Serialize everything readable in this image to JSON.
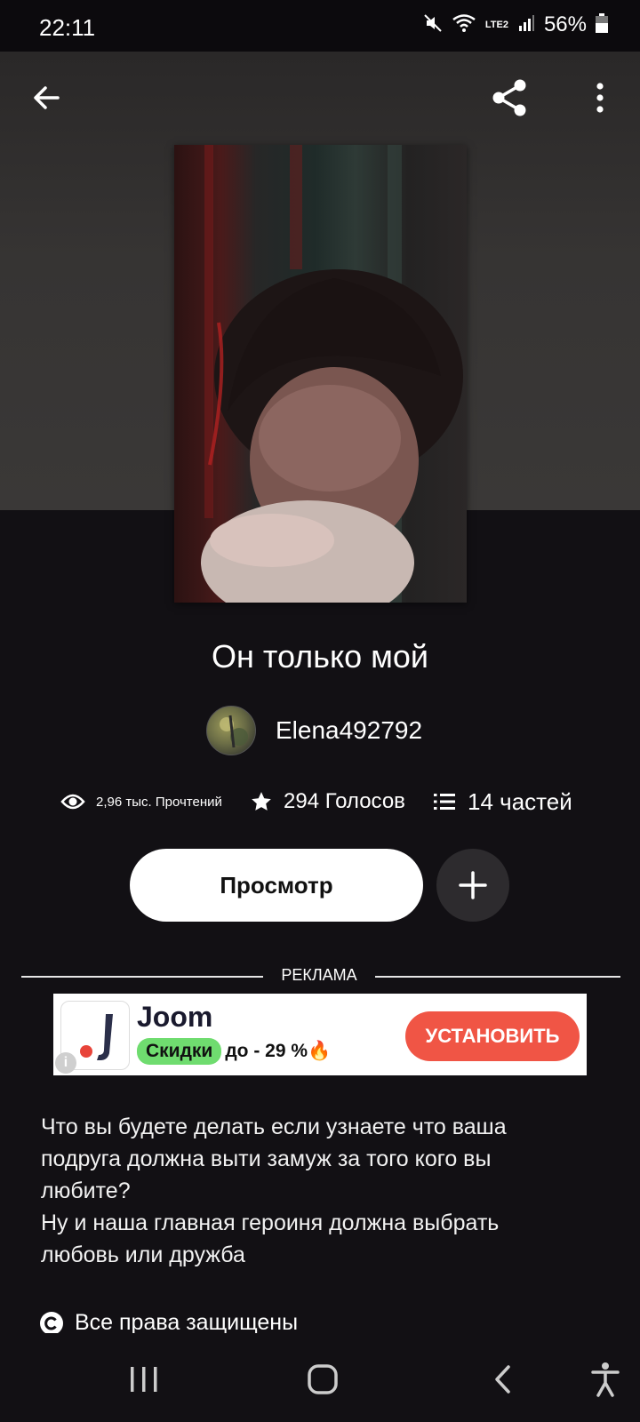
{
  "status_bar": {
    "time": "22:11",
    "battery": "56%",
    "network": "LTE2",
    "icons": [
      "mute-icon",
      "wifi-icon",
      "signal-icon",
      "battery-icon"
    ]
  },
  "top_nav": {
    "back_icon": "arrow-left-icon",
    "share_icon": "share-icon",
    "more_icon": "more-vertical-icon"
  },
  "story": {
    "title": "Он только мой",
    "author": "Elena492792",
    "stats": {
      "reads": "2,96 тыс. Прочтений",
      "votes": "294 Голосов",
      "parts": "14 частей"
    },
    "view_button": "Просмотр",
    "add_button_icon": "plus-icon",
    "description_lines": [
      "Что вы будете делать если узнаете что ваша",
      "подруга должна выти замуж за того кого вы",
      "любите?",
      "Ну и наша главная героиня должна выбрать",
      "любовь или дружба"
    ],
    "copyright": "Все права защищены"
  },
  "ad": {
    "label": "РЕКЛАМА",
    "brand": "Joom",
    "chip": "Скидки",
    "rest": "до - 29 %🔥",
    "install": "УСТАНОВИТЬ",
    "info": "i"
  },
  "bottom_nav": {
    "items": [
      "recents-icon",
      "home-icon",
      "back-icon",
      "accessibility-icon"
    ]
  },
  "colors": {
    "background": "#121014",
    "hero": "#363433",
    "ad_install": "#f05545",
    "ad_chip": "#6fdc6f",
    "add_button": "#2d2b2e"
  }
}
